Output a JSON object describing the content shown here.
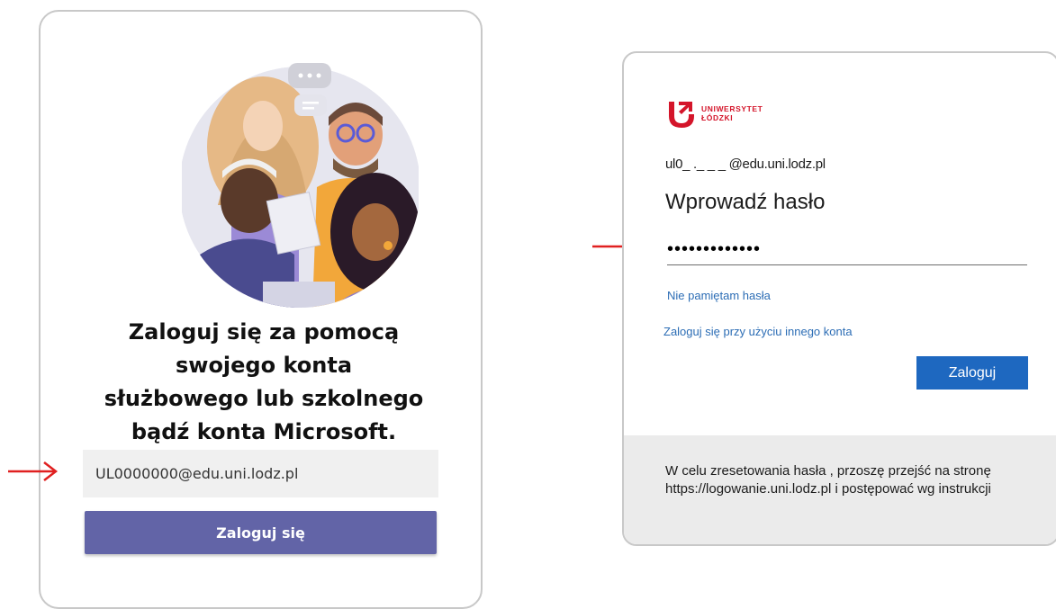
{
  "teams_login": {
    "headline_lines": [
      "Zaloguj się za pomocą",
      "swojego konta",
      "służbowego lub szkolnego",
      "bądź konta Microsoft."
    ],
    "email_value": "UL0000000@edu.uni.lodz.pl",
    "signin_label": "Zaloguj się",
    "button_color": "#6264a7"
  },
  "ms_login": {
    "brand_lines": [
      "UNIWERSYTET",
      "ŁÓDZKI"
    ],
    "brand_color": "#d4152a",
    "account_email": "ul0_ ._ _ _ @edu.uni.lodz.pl",
    "title": "Wprowadź hasło",
    "password_mask": "•••••••••••••",
    "forgot_link": "Nie pamiętam hasła",
    "other_account_link": "Zaloguj się przy użyciu innego konta",
    "signin_label": "Zaloguj",
    "button_color": "#1e68c0",
    "info_text": "W celu zresetowania hasła , przoszę przejść na stronę https://logowanie.uni.lodz.pl i postępować wg instrukcji"
  },
  "annotations": {
    "arrow_color": "#e02020",
    "arrow_icons": [
      "arrow-right-icon",
      "arrow-right-icon"
    ]
  }
}
